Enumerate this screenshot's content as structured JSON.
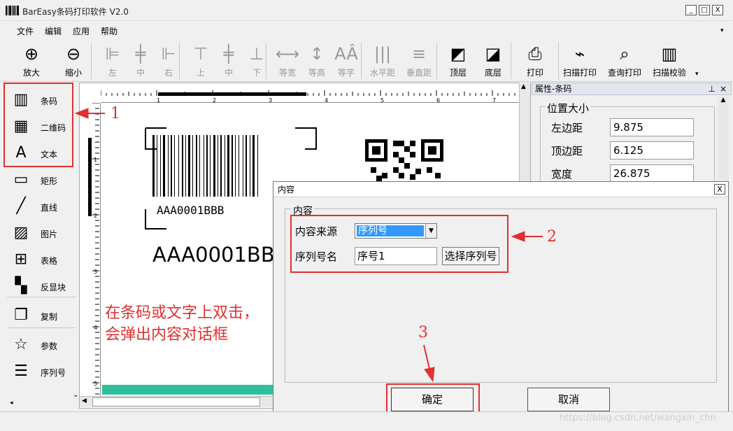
{
  "app": {
    "title": "BarEasy条码打印软件 V2.0"
  },
  "window_controls": {
    "minimize": "_",
    "maximize": "□",
    "close": "X"
  },
  "menu": [
    "文件",
    "编辑",
    "应用",
    "帮助"
  ],
  "toolbar": [
    {
      "label": "放大",
      "icon": "zoom-in-icon",
      "glyph": "⊕",
      "enabled": true
    },
    {
      "label": "缩小",
      "icon": "zoom-out-icon",
      "glyph": "⊖",
      "enabled": true
    },
    {
      "label": "左",
      "icon": "align-left-icon",
      "glyph": "⊫",
      "enabled": false
    },
    {
      "label": "中",
      "icon": "align-center-icon",
      "glyph": "╪",
      "enabled": false
    },
    {
      "label": "右",
      "icon": "align-right-icon",
      "glyph": "⊩",
      "enabled": false
    },
    {
      "label": "上",
      "icon": "align-top-icon",
      "glyph": "⊤",
      "enabled": false
    },
    {
      "label": "中",
      "icon": "align-middle-icon",
      "glyph": "╪",
      "enabled": false
    },
    {
      "label": "下",
      "icon": "align-bottom-icon",
      "glyph": "⊥",
      "enabled": false
    },
    {
      "label": "等宽",
      "icon": "same-width-icon",
      "glyph": "⟷",
      "enabled": false
    },
    {
      "label": "等高",
      "icon": "same-height-icon",
      "glyph": "↕",
      "enabled": false
    },
    {
      "label": "等字",
      "icon": "same-font-icon",
      "glyph": "AÂ",
      "enabled": false
    },
    {
      "label": "水平距",
      "icon": "horizontal-spacing-icon",
      "glyph": "|||",
      "enabled": false
    },
    {
      "label": "垂直距",
      "icon": "vertical-spacing-icon",
      "glyph": "≡",
      "enabled": false
    },
    {
      "label": "顶层",
      "icon": "bring-to-front-icon",
      "glyph": "◩",
      "enabled": true
    },
    {
      "label": "底层",
      "icon": "send-to-back-icon",
      "glyph": "◪",
      "enabled": true
    },
    {
      "label": "打印",
      "icon": "printer-icon",
      "glyph": "⎙",
      "enabled": true
    },
    {
      "label": "扫描打印",
      "icon": "scanner-icon",
      "glyph": "⌁",
      "enabled": true
    },
    {
      "label": "查询打印",
      "icon": "search-icon",
      "glyph": "⌕",
      "enabled": true
    },
    {
      "label": "扫描校验",
      "icon": "barcode-check-icon",
      "glyph": "▥",
      "enabled": true
    }
  ],
  "tools": [
    {
      "label": "条码",
      "icon": "barcode-icon",
      "glyph": "▥"
    },
    {
      "label": "二维码",
      "icon": "qrcode-icon",
      "glyph": "▦"
    },
    {
      "label": "文本",
      "icon": "text-icon",
      "glyph": "A"
    },
    {
      "label": "矩形",
      "icon": "rectangle-icon",
      "glyph": "▭"
    },
    {
      "label": "直线",
      "icon": "line-icon",
      "glyph": "╱"
    },
    {
      "label": "图片",
      "icon": "image-icon",
      "glyph": "▨"
    },
    {
      "label": "表格",
      "icon": "table-icon",
      "glyph": "⊞"
    },
    {
      "label": "反显块",
      "icon": "inverse-block-icon",
      "glyph": "▚"
    },
    {
      "label": "复制",
      "icon": "copy-icon",
      "glyph": "❐"
    },
    {
      "label": "参数",
      "icon": "star-icon",
      "glyph": "☆"
    },
    {
      "label": "序列号",
      "icon": "numbered-list-icon",
      "glyph": "☰"
    }
  ],
  "ruler": {
    "h_ticks": [
      "1",
      "2",
      "3",
      "4",
      "5",
      "6",
      "7"
    ],
    "v_ticks": [
      "1",
      "2",
      "3",
      "4",
      "5"
    ]
  },
  "canvas": {
    "barcode_caption": "AAA0001BBB",
    "text_object": "AAA0001BB"
  },
  "properties": {
    "header": "属性-条码",
    "group": "位置大小",
    "fields": [
      {
        "label": "左边距",
        "value": "9.875"
      },
      {
        "label": "顶边距",
        "value": "6.125"
      },
      {
        "label": "宽度",
        "value": "26.875"
      }
    ]
  },
  "dialog": {
    "title": "内容",
    "group": "内容",
    "source_label": "内容来源",
    "source_value": "序列号",
    "name_label": "序列号名",
    "name_value": "序号1",
    "pick_button": "选择序列号",
    "ok": "确定",
    "cancel": "取消"
  },
  "annotations": {
    "step1": "1",
    "step2": "2",
    "step3": "3",
    "hint": "在条码或文字上双击，\n会弹出内容对话框"
  },
  "watermark": "https://blog.csdn.net/wangxin_chn",
  "colors": {
    "annotation": "#e03030",
    "selection": "#3399ff",
    "teal": "#2ebf9f"
  }
}
